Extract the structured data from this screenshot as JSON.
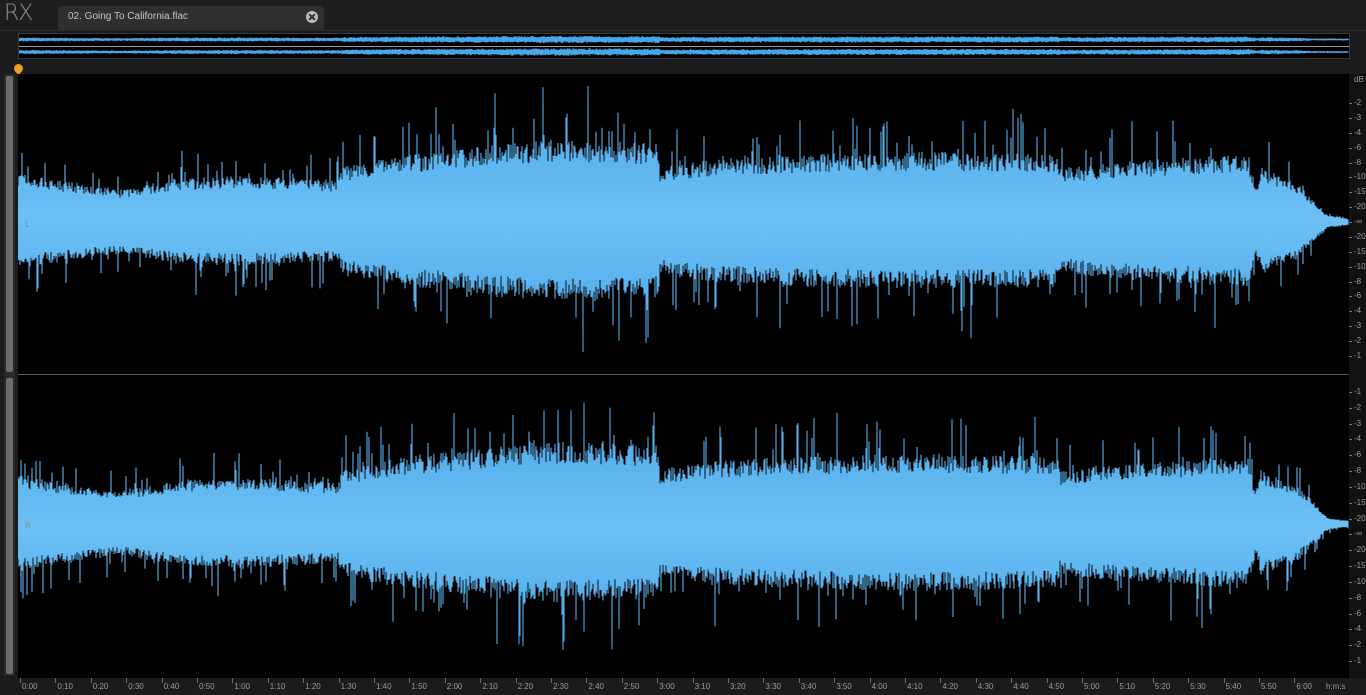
{
  "app": {
    "logo": "RX"
  },
  "tab": {
    "label": "02. Going To California.flac"
  },
  "channels": [
    {
      "label": "L"
    },
    {
      "label": "R"
    }
  ],
  "db_unit": "dB",
  "db_scale_top": [
    "-2",
    "-3",
    "-4",
    "-6",
    "-8",
    "-10",
    "-15",
    "-20",
    "-∞",
    "-20",
    "-15",
    "-10",
    "-8",
    "-6",
    "-4",
    "-3",
    "-2",
    "-1"
  ],
  "db_scale_bottom": [
    "-1",
    "-2",
    "-3",
    "-4",
    "-6",
    "-8",
    "-10",
    "-15",
    "-20",
    "-∞",
    "-20",
    "-15",
    "-10",
    "-8",
    "-6",
    "-4",
    "-2",
    "-1"
  ],
  "time_unit": "h:m:s",
  "time_labels": [
    "0:00",
    "0:10",
    "0:20",
    "0:30",
    "0:40",
    "0:50",
    "1:00",
    "1:10",
    "1:20",
    "1:30",
    "1:40",
    "1:50",
    "2:00",
    "2:10",
    "2:20",
    "2:30",
    "2:40",
    "2:50",
    "3:00",
    "3:10",
    "3:20",
    "3:30",
    "3:40",
    "3:50",
    "4:00",
    "4:10",
    "4:20",
    "4:30",
    "4:40",
    "4:50",
    "5:00",
    "5:10",
    "5:20",
    "5:30",
    "5:40",
    "5:50",
    "6:00"
  ],
  "colors": {
    "waveform": "#4aa6e6",
    "playhead": "#f0a020",
    "background": "#000000"
  }
}
